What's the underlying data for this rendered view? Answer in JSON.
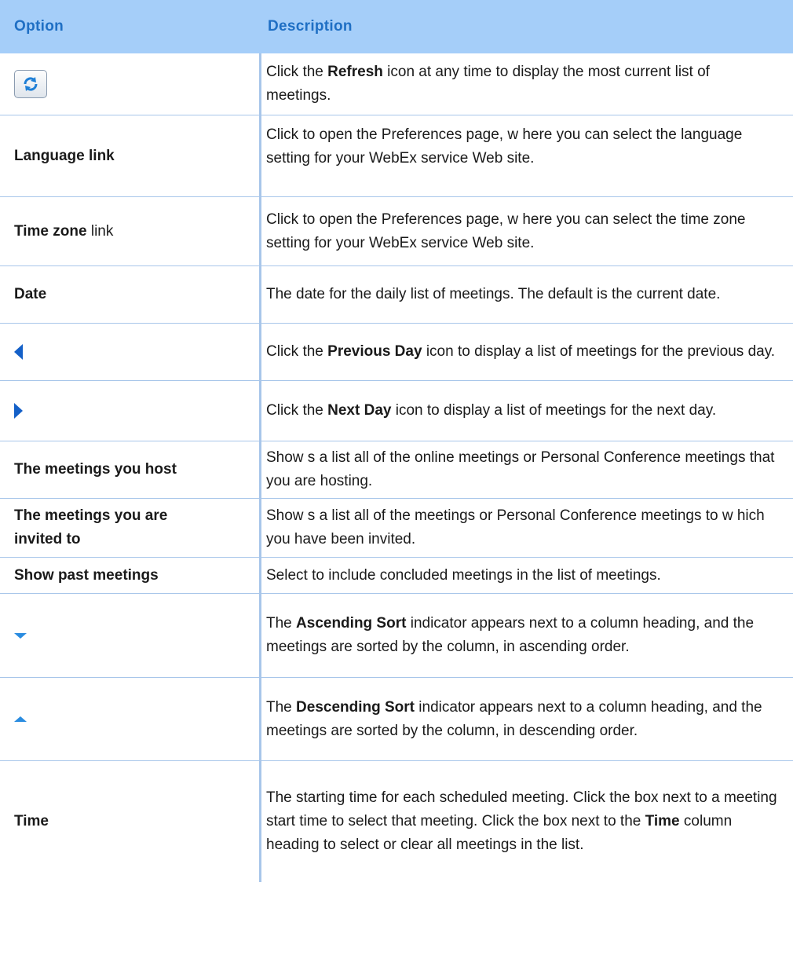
{
  "header": {
    "option": "Option",
    "description": "Description"
  },
  "rows": [
    {
      "icon": "refresh-icon",
      "desc": [
        "Click the ",
        "Refresh",
        " icon at any time to display the most current list of meetings."
      ]
    },
    {
      "option": [
        "Language link",
        ""
      ],
      "desc": [
        "Click to open the Preferences page, w here you can select the language setting for your WebEx service Web site."
      ]
    },
    {
      "option": [
        "Time zone",
        " link"
      ],
      "desc": [
        "Click to open the Preferences page, w here you can select the time zone setting for your WebEx service Web site."
      ]
    },
    {
      "option": [
        "Date",
        ""
      ],
      "desc": [
        "The date for the daily list of meetings. The default is the current date."
      ]
    },
    {
      "icon": "previous-day-icon",
      "desc": [
        "Click the ",
        "Previous Day",
        " icon to display a list of meetings for the previous day."
      ]
    },
    {
      "icon": "next-day-icon",
      "desc": [
        "Click the ",
        "Next Day",
        " icon to display a list of meetings for the next day."
      ]
    },
    {
      "option": [
        "The meetings you host",
        ""
      ],
      "desc": [
        "Show s a list all of the online meetings or Personal Conference meetings that you are hosting."
      ]
    },
    {
      "option": [
        "The meetings you are invited to",
        ""
      ],
      "desc": [
        "Show s a list all of the meetings or Personal Conference meetings to w hich you have been invited."
      ]
    },
    {
      "option": [
        "Show past meetings",
        ""
      ],
      "desc": [
        "Select to include concluded meetings in the list of meetings."
      ]
    },
    {
      "icon": "ascending-sort-icon",
      "desc": [
        "The ",
        "Ascending Sort",
        " indicator appears next to a column heading, and the meetings are sorted by the column, in ascending order."
      ]
    },
    {
      "icon": "descending-sort-icon",
      "desc": [
        "The ",
        "Descending Sort",
        " indicator appears next to a column heading, and the meetings are sorted by the column, in descending order."
      ]
    },
    {
      "option": [
        "Time",
        ""
      ],
      "desc": [
        "The starting time for each scheduled meeting. Click the box next to a meeting start time to select that meeting. Click the box next to the ",
        "Time",
        " column heading to select or clear all meetings in the list."
      ]
    }
  ],
  "colors": {
    "header_bg": "#a5cef9",
    "header_text": "#1f6fc4",
    "grid": "#a8c6ea",
    "icon_blue": "#1460c8"
  }
}
